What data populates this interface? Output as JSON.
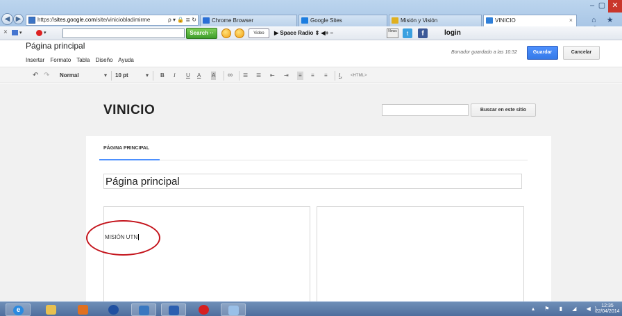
{
  "browser": {
    "address_url": "https://sites.google.com/site/viniciobladimirme",
    "address_host_bold": "sites.google.com",
    "address_search_glyphs": "ρ ▾ 🔒 ≣ ↻",
    "tabs": [
      {
        "label": "Chrome Browser",
        "icon_color": "#2a6fd6"
      },
      {
        "label": "Google Sites",
        "icon_color": "#1c7de0"
      },
      {
        "label": "Misión y Visión",
        "icon_color": "#e0b020"
      },
      {
        "label": "VINICIO",
        "icon_color": "#2f7fd8"
      }
    ],
    "tab_close": "×",
    "window_minimize": "–",
    "window_maximize": "▢",
    "window_close": "✕",
    "right_icons": "⌂ ★ ⚙"
  },
  "toolbar": {
    "close": "×",
    "search_button": "Search ··",
    "video_label": "Video",
    "space_radio": "▶  Space Radio  ⇕  ◀+ –",
    "news_label": "News",
    "twitter_glyph": "t",
    "facebook_glyph": "f",
    "login": "login"
  },
  "editor": {
    "page_title": "Página principal",
    "menu": [
      "Insertar",
      "Formato",
      "Tabla",
      "Diseño",
      "Ayuda"
    ],
    "draft_status": "Borrador guardado a las 10:32",
    "save_label": "Guardar",
    "cancel_label": "Cancelar",
    "format_bar": {
      "undo": "↶",
      "redo": "↷",
      "style": "Normal",
      "dropdown": "▾",
      "size": "10 pt",
      "bold": "B",
      "italic": "I",
      "underline": "U",
      "text_color": "A",
      "highlight": "A",
      "link": "∞",
      "numbered_list": "☰",
      "bulleted_list": "☰",
      "outdent": "⇤",
      "indent": "⇥",
      "align_left": "≡",
      "align_center": "≡",
      "align_right": "≡",
      "clear_format": "Ix",
      "html": "<HTML>"
    }
  },
  "site": {
    "title": "VINICIO",
    "search_button": "Buscar en este sitio",
    "nav_tab": "PÁGINA PRINCIPAL",
    "page_heading": "Página principal",
    "left_column_text": "MISIÓN UTN"
  },
  "taskbar": {
    "tray_icons": "▴ ⚑ ▮ ◢ ◀)",
    "time": "12:35",
    "date": "22/04/2014"
  }
}
